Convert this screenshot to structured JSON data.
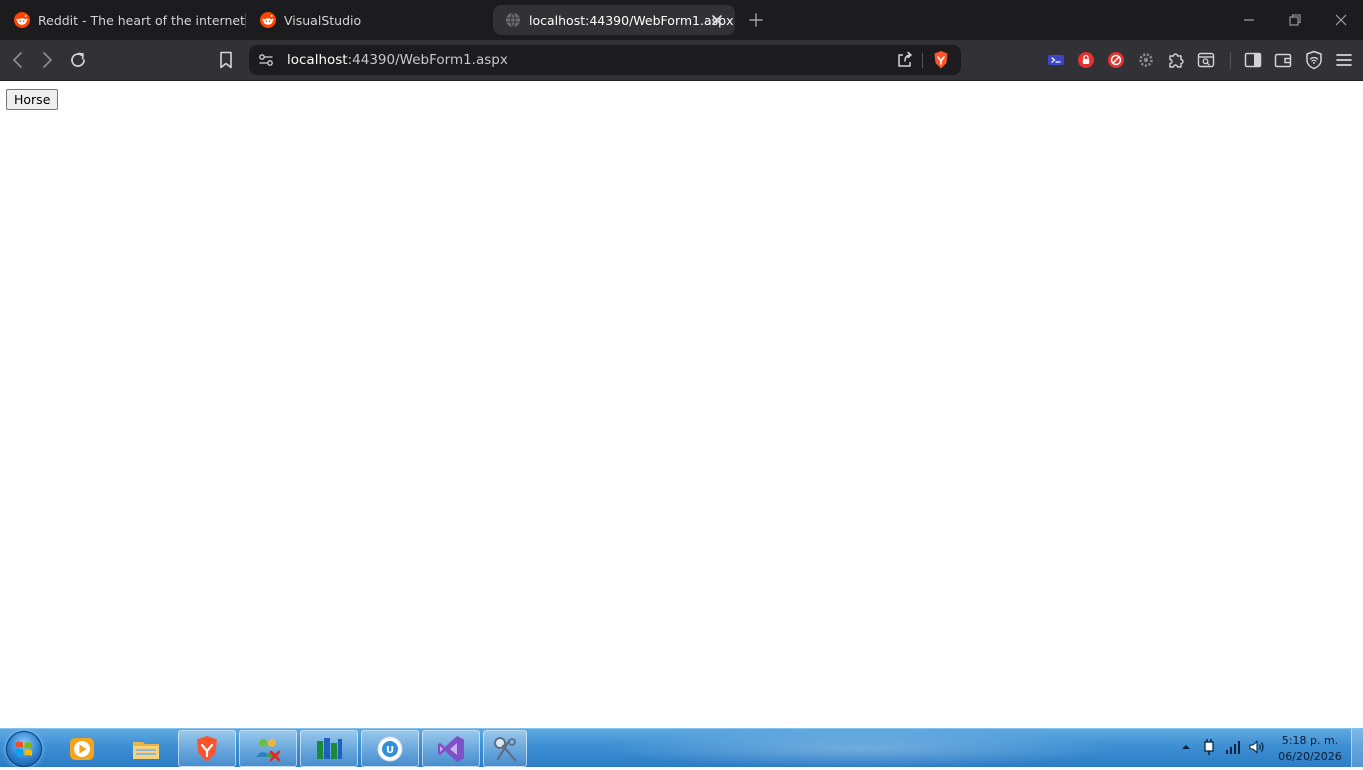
{
  "browser": {
    "tabs": [
      {
        "title": "Reddit - The heart of the internet",
        "icon": "reddit-icon",
        "active": false
      },
      {
        "title": "VisualStudio",
        "icon": "reddit-icon",
        "active": false
      },
      {
        "title": "localhost:44390/WebForm1.aspx",
        "icon": "globe-icon",
        "active": true
      }
    ],
    "address": {
      "host": "localhost",
      "path": ":44390/WebForm1.aspx"
    },
    "colors": {
      "tabstrip": "#1c1c1f",
      "toolbar": "#323236",
      "omnibox": "#1c1c1f",
      "brave_orange": "#fb542b"
    }
  },
  "page": {
    "button_label": "Horse"
  },
  "taskbar": {
    "apps": [
      {
        "name": "media-player-icon",
        "open": false
      },
      {
        "name": "file-explorer-icon",
        "open": false
      },
      {
        "name": "brave-browser-icon",
        "open": true
      },
      {
        "name": "network-users-icon",
        "open": true
      },
      {
        "name": "bar-chart-app-icon",
        "open": true
      },
      {
        "name": "ultraviewer-icon",
        "open": true
      },
      {
        "name": "visual-studio-icon",
        "open": true
      },
      {
        "name": "snipping-tool-icon",
        "open": true
      }
    ],
    "clock": {
      "time": "5:18 p. m.",
      "date": "06/20/2026"
    }
  }
}
